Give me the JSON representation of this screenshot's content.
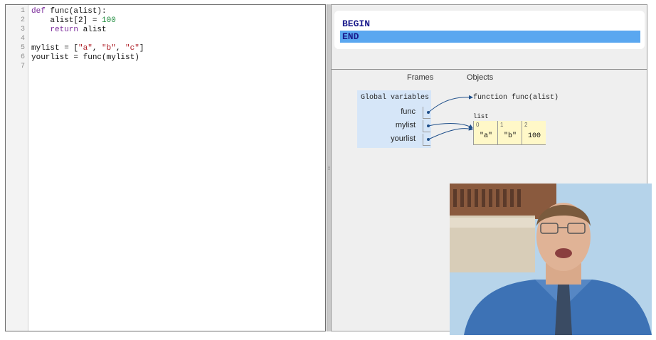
{
  "editor": {
    "line_numbers": [
      "1",
      "2",
      "3",
      "4",
      "5",
      "6",
      "7"
    ]
  },
  "code": {
    "l1": {
      "kw": "def",
      "rest": " func(alist):"
    },
    "l2": {
      "pre": "    alist[2] = ",
      "num": "100"
    },
    "l3": {
      "pre": "    ",
      "kw": "return",
      "rest": " alist"
    },
    "l5": {
      "pre": "mylist = [",
      "s1": "\"a\"",
      "c1": ", ",
      "s2": "\"b\"",
      "c2": ", ",
      "s3": "\"c\"",
      "post": "]"
    },
    "l6": "yourlist = func(mylist)"
  },
  "output": {
    "begin": "BEGIN",
    "end": "END"
  },
  "viz": {
    "frames_header": "Frames",
    "objects_header": "Objects",
    "frame_title": "Global variables",
    "vars": [
      "func",
      "mylist",
      "yourlist"
    ],
    "function_label": "function func(alist)",
    "list_label": "list",
    "list_indices": [
      "0",
      "1",
      "2"
    ],
    "list_values": [
      "\"a\"",
      "\"b\"",
      "100"
    ]
  },
  "colors": {
    "output_highlight": "#5aa7f0",
    "frame_bg": "#d6e6f8",
    "list_bg": "#fff8c8",
    "arrow": "#1f4f8a"
  },
  "icons": {
    "divider_grip": "vertical-grip-icon",
    "video_overlay": "presenter-video"
  }
}
